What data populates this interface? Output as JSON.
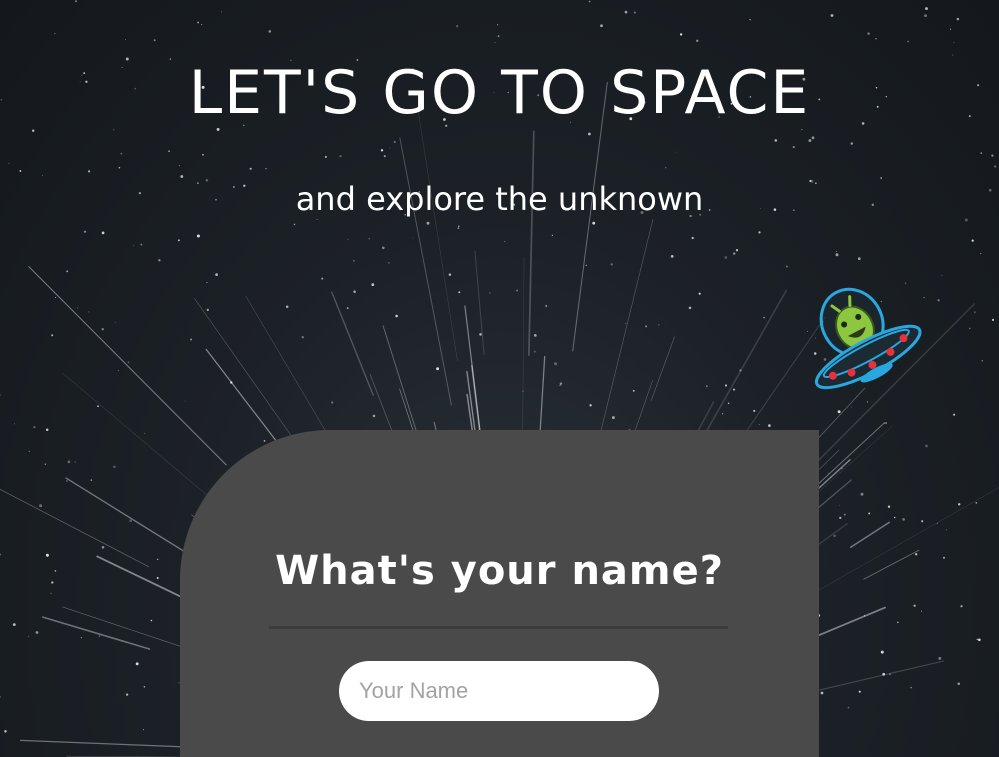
{
  "hero": {
    "title": "LET'S GO TO SPACE",
    "subtitle": "and explore the unknown"
  },
  "alien": {
    "icon": "alien-ufo-icon"
  },
  "form": {
    "question": "What's your name?",
    "name_placeholder": "Your Name",
    "name_value": ""
  },
  "colors": {
    "background": "#1c2127",
    "card": "#4a4a4a",
    "text": "#ffffff",
    "alien_green": "#8dc63f",
    "ufo_blue": "#29a8e0",
    "ufo_red": "#e8313a"
  }
}
